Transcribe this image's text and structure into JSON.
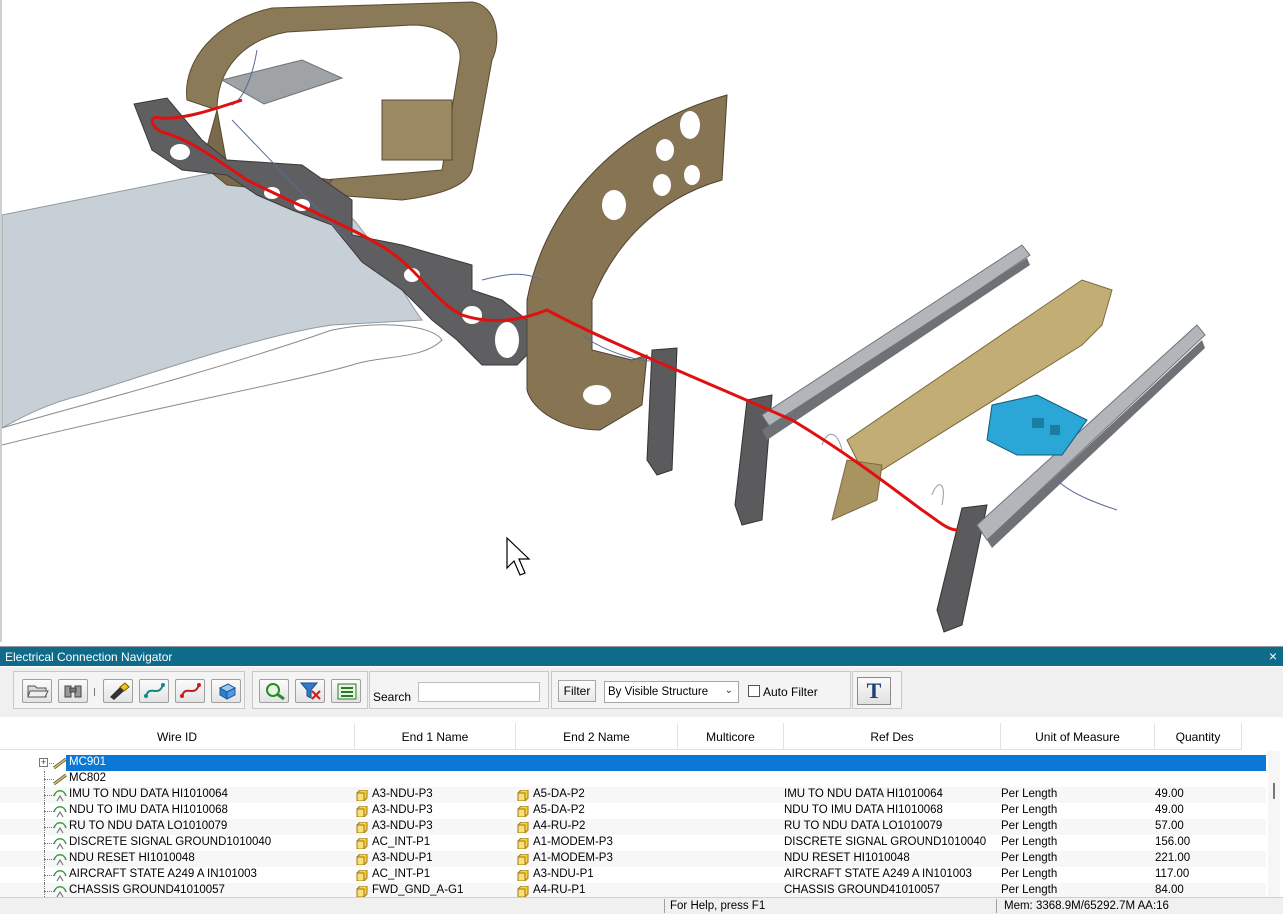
{
  "navigator": {
    "title": "Electrical Connection Navigator",
    "close_glyph": "×",
    "toolbar": {
      "search_label": "Search",
      "search_value": "",
      "filter_label": "Filter",
      "filter_mode": "By Visible Structure",
      "auto_filter_label": "Auto Filter",
      "auto_filter_checked": false,
      "text_button_label": "T",
      "icons": [
        "open-folder-icon",
        "binoculars-icon",
        "flashlight-icon",
        "route-icon",
        "unroute-icon",
        "3d-box-icon",
        "zoom-icon",
        "filter-clear-icon",
        "list-view-icon"
      ]
    },
    "columns": [
      "Wire ID",
      "End 1 Name",
      "End 2 Name",
      "Multicore",
      "Ref Des",
      "Unit of Measure",
      "Quantity"
    ],
    "rows": [
      {
        "wire_id": "MC901",
        "type": "cable",
        "selected": true,
        "expandable": true,
        "end1": "",
        "end2": "",
        "multicore": "",
        "refdes": "",
        "uom": "",
        "qty": ""
      },
      {
        "wire_id": "MC802",
        "type": "cable",
        "selected": false,
        "expandable": false,
        "end1": "",
        "end2": "",
        "multicore": "",
        "refdes": "",
        "uom": "",
        "qty": ""
      },
      {
        "wire_id": "IMU TO NDU DATA HI1010064",
        "type": "wire",
        "end1": "A3-NDU-P3",
        "end2": "A5-DA-P2",
        "multicore": "",
        "refdes": "IMU TO NDU DATA HI1010064",
        "uom": "Per Length",
        "qty": "49.00"
      },
      {
        "wire_id": "NDU TO IMU DATA HI1010068",
        "type": "wire",
        "end1": "A3-NDU-P3",
        "end2": "A5-DA-P2",
        "multicore": "",
        "refdes": "NDU TO IMU DATA HI1010068",
        "uom": "Per Length",
        "qty": "49.00"
      },
      {
        "wire_id": "RU TO NDU DATA LO1010079",
        "type": "wire",
        "end1": "A3-NDU-P3",
        "end2": "A4-RU-P2",
        "multicore": "",
        "refdes": "RU TO NDU DATA LO1010079",
        "uom": "Per Length",
        "qty": "57.00"
      },
      {
        "wire_id": "DISCRETE SIGNAL GROUND1010040",
        "type": "wire",
        "end1": "AC_INT-P1",
        "end2": "A1-MODEM-P3",
        "multicore": "",
        "refdes": "DISCRETE SIGNAL GROUND1010040",
        "uom": "Per Length",
        "qty": "156.00"
      },
      {
        "wire_id": "NDU RESET HI1010048",
        "type": "wire",
        "end1": "A3-NDU-P1",
        "end2": "A1-MODEM-P3",
        "multicore": "",
        "refdes": "NDU RESET HI1010048",
        "uom": "Per Length",
        "qty": "221.00"
      },
      {
        "wire_id": "AIRCRAFT STATE A249 A IN101003",
        "type": "wire",
        "end1": "AC_INT-P1",
        "end2": "A3-NDU-P1",
        "multicore": "",
        "refdes": "AIRCRAFT STATE A249 A IN101003",
        "uom": "Per Length",
        "qty": "117.00"
      },
      {
        "wire_id": "CHASSIS GROUND41010057",
        "type": "wire",
        "end1": "FWD_GND_A-G1",
        "end2": "A4-RU-P1",
        "multicore": "",
        "refdes": "CHASSIS GROUND41010057",
        "uom": "Per Length",
        "qty": "84.00"
      }
    ]
  },
  "status_bar": {
    "help": "For Help, press F1",
    "memory": "Mem: 3368.9M/65292.7M  AA:16"
  },
  "colors": {
    "title_bar": "#0f6b8a",
    "selection": "#0a78d7",
    "wire_route": "#e01010",
    "frame_brown": "#7d6c4f",
    "frame_tan": "#b9a56f",
    "grey_part": "#5d5d5d",
    "panel_blue": "#2aa7d6",
    "skin": "#c3ccd3"
  }
}
